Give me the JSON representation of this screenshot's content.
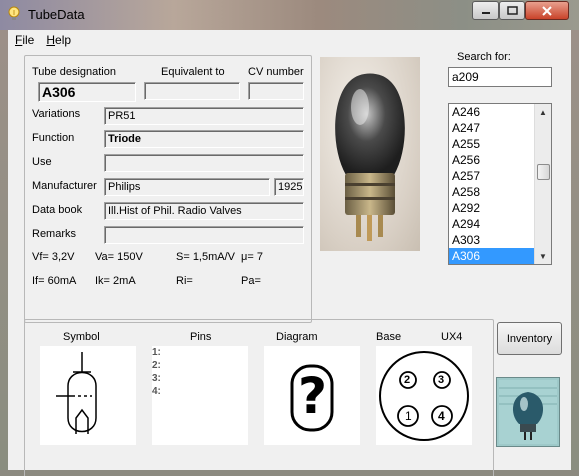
{
  "window": {
    "title": "TubeData"
  },
  "menu": [
    {
      "label": "File",
      "underline": "F",
      "rest": "ile"
    },
    {
      "label": "Help",
      "underline": "H",
      "rest": "elp"
    }
  ],
  "tube": {
    "labels": {
      "designation": "Tube designation",
      "equivalent": "Equivalent to",
      "cv": "CV number",
      "variations": "Variations",
      "function": "Function",
      "use": "Use",
      "manufacturer": "Manufacturer",
      "data_book": "Data book",
      "remarks": "Remarks"
    },
    "designation": "A306",
    "equivalent": "",
    "cv_number": "",
    "variations": "PR51",
    "function": "Triode",
    "use": "",
    "manufacturer": "Philips",
    "year": "1925",
    "data_book": "Ill.Hist of Phil. Radio Valves",
    "remarks": ""
  },
  "params": {
    "vf": "Vf= 3,2V",
    "va": "Va= 150V",
    "s": "S= 1,5mA/V",
    "mu": "μ=  7",
    "if": "If= 60mA",
    "ik": "Ik=  2mA",
    "ri": "Ri=",
    "pa": "Pa="
  },
  "search": {
    "label": "Search for:",
    "value": "a209"
  },
  "list": {
    "items": [
      "A246",
      "A247",
      "A255",
      "A256",
      "A257",
      "A258",
      "A292",
      "A294",
      "A303",
      "A306"
    ],
    "selected": "A306"
  },
  "bottom": {
    "symbol": "Symbol",
    "pins": "Pins",
    "diagram": "Diagram",
    "base": "Base",
    "base_type": "UX4",
    "pin_numbers": [
      "1:",
      "2:",
      "3:",
      "4:"
    ],
    "diagram_glyph": "?",
    "base_pins": [
      "2",
      "3",
      "1",
      "4"
    ]
  },
  "buttons": {
    "inventory": "Inventory"
  },
  "icons": {
    "app": "lightbulb-icon",
    "tube_photo": "vacuum-tube-photo",
    "logo": "tube-logo-icon"
  }
}
